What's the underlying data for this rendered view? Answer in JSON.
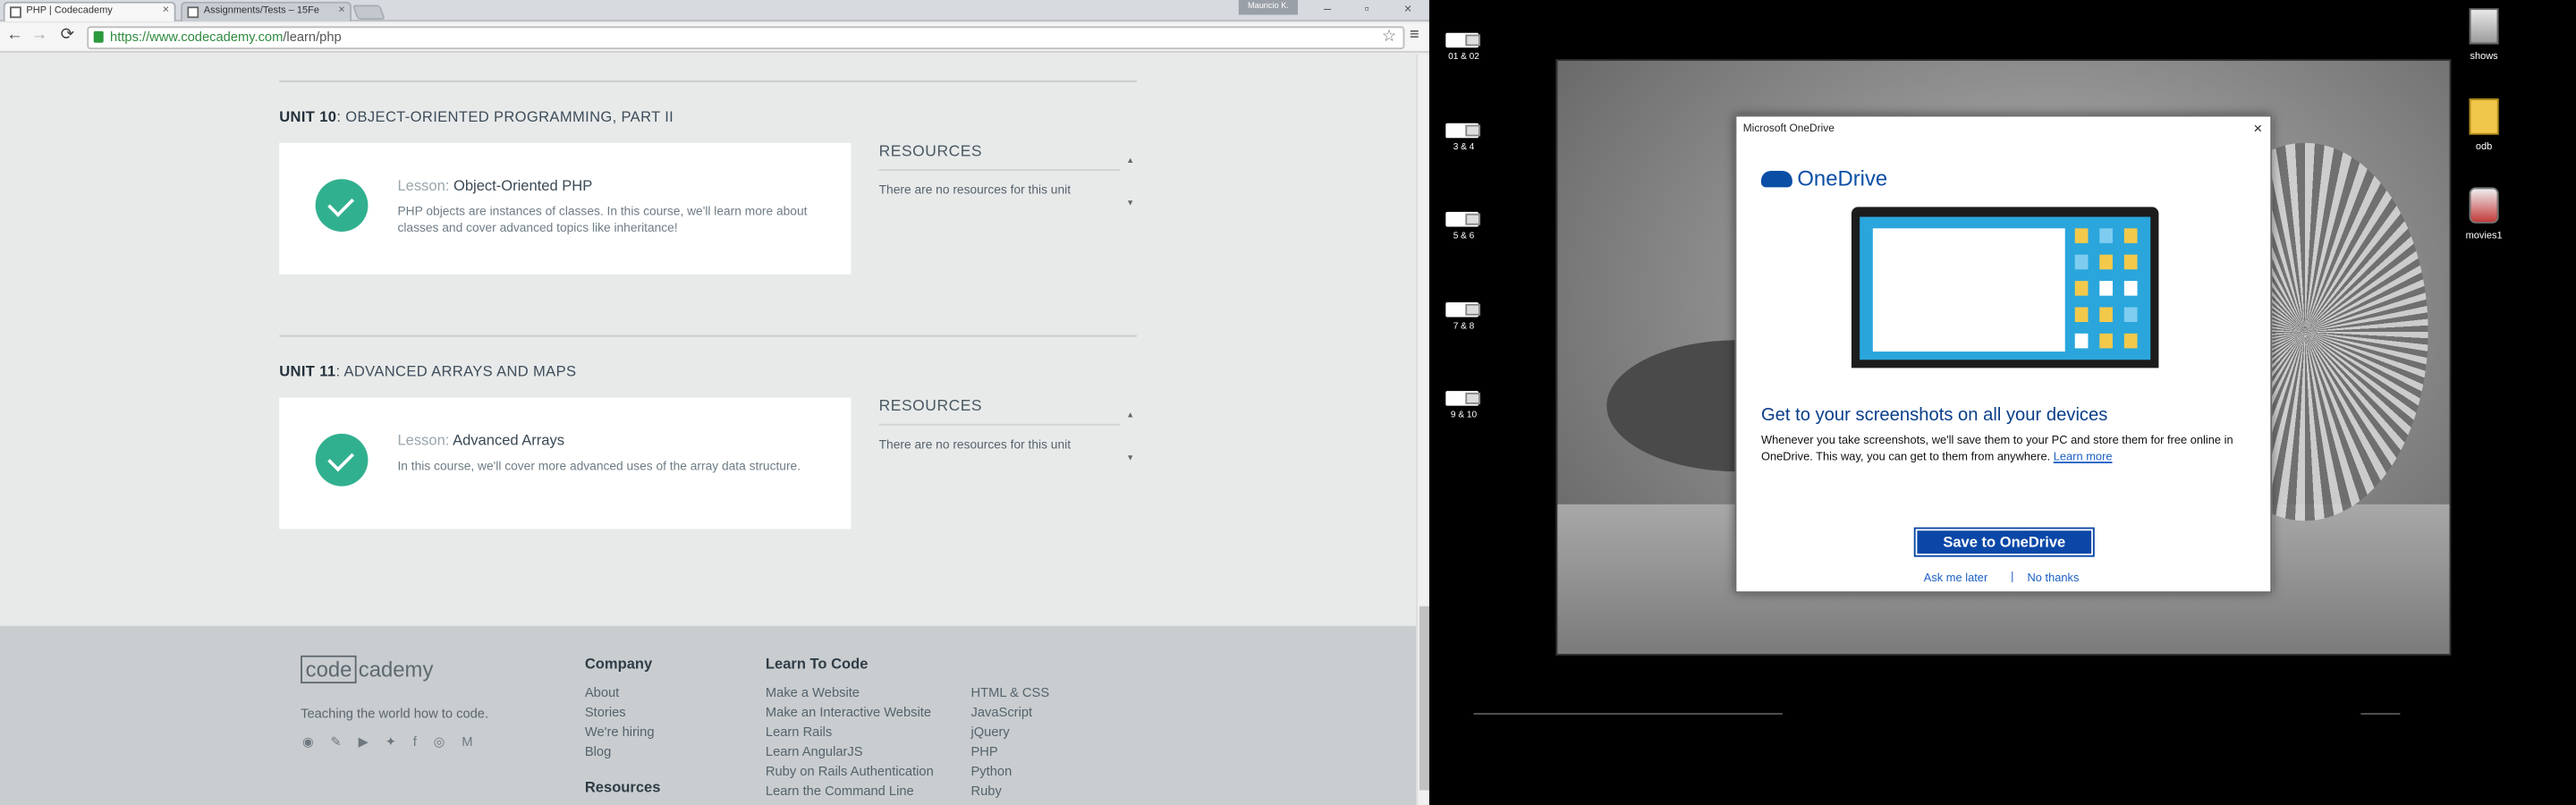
{
  "browser": {
    "tabs": [
      {
        "title": "PHP | Codecademy",
        "active": true
      },
      {
        "title": "Assignments/Tests – 15Fe",
        "active": false
      }
    ],
    "user_badge": "Mauricio K.",
    "url_host": "https://www.codecademy.com",
    "url_path": "/learn/php",
    "window_controls": {
      "minimize": "–",
      "maximize": "▫",
      "close": "×"
    },
    "nav": {
      "back": "←",
      "forward": "→",
      "reload": "⟳",
      "star": "☆",
      "menu": "≡"
    }
  },
  "units": [
    {
      "number": "UNIT 10",
      "name": ": OBJECT-ORIENTED PROGRAMMING, PART II",
      "lesson_label": "Lesson: ",
      "lesson_name": "Object-Oriented PHP",
      "description": "PHP objects are instances of classes. In this course, we'll learn more about classes and cover advanced topics like inheritance!",
      "resources_title": "RESOURCES",
      "resources_text": "There are no resources for this unit"
    },
    {
      "number": "UNIT 11",
      "name": ": ADVANCED ARRAYS AND MAPS",
      "lesson_label": "Lesson: ",
      "lesson_name": "Advanced Arrays",
      "description": "In this course, we'll cover more advanced uses of the array data structure.",
      "resources_title": "RESOURCES",
      "resources_text": "There are no resources for this unit"
    }
  ],
  "footer": {
    "logo_box": "code",
    "logo_rest": "cademy",
    "tagline": "Teaching the world how to code.",
    "social_icons": [
      "reddit-icon",
      "pinterest-icon",
      "youtube-icon",
      "twitter-icon",
      "facebook-icon",
      "instagram-icon",
      "medium-icon"
    ],
    "social_glyphs": "◉ ✎ ▶ ✦ f ◎ M",
    "company_heading": "Company",
    "company_links": [
      "About",
      "Stories",
      "We're hiring",
      "Blog"
    ],
    "resources_heading": "Resources",
    "learn_heading": "Learn To Code",
    "learn_links_1": [
      "Make a Website",
      "Make an Interactive Website",
      "Learn Rails",
      "Learn AngularJS",
      "Ruby on Rails Authentication",
      "Learn the Command Line"
    ],
    "learn_links_2": [
      "HTML & CSS",
      "JavaScript",
      "jQuery",
      "PHP",
      "Python",
      "Ruby"
    ]
  },
  "desktop": {
    "left_icons": [
      "01 & 02",
      "3 & 4",
      "5 & 6",
      "7 & 8",
      "9 & 10"
    ],
    "right_icons": [
      "shows",
      "odb",
      "movies1"
    ]
  },
  "onedrive_dialog": {
    "window_title": "Microsoft OneDrive",
    "close": "×",
    "brand": "OneDrive",
    "heading": "Get to your screenshots on all your devices",
    "body": "Whenever you take screenshots, we'll save them to your PC and store them for free online in OneDrive. This way, you can get to them from anywhere. ",
    "learn_more": "Learn more",
    "save_button": "Save to OneDrive",
    "ask_later": "Ask me later",
    "separator": "|",
    "no_thanks": "No thanks"
  }
}
